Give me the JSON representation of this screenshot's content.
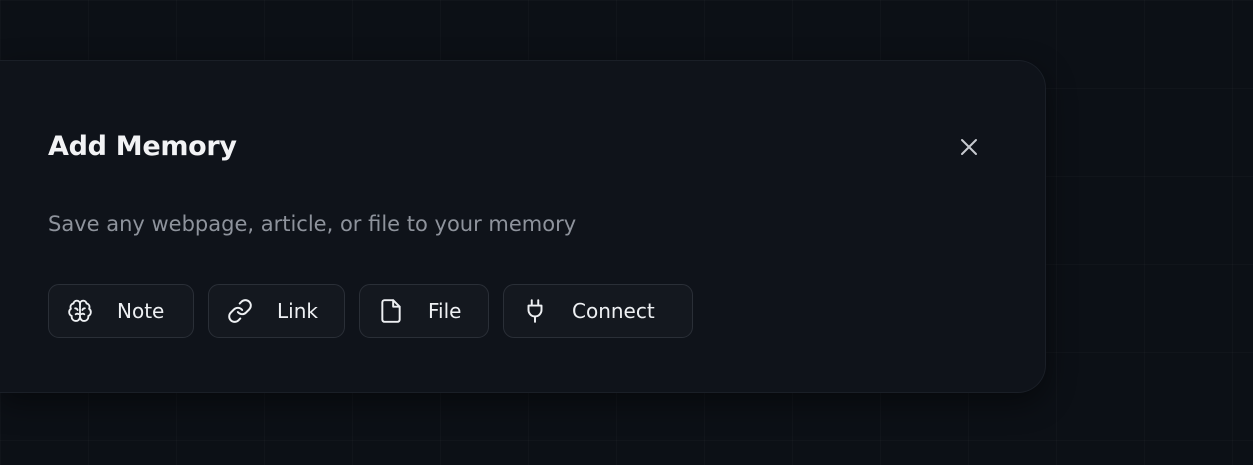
{
  "modal": {
    "title": "Add Memory",
    "subtitle": "Save any webpage, article, or file to your memory",
    "close_icon": "close-icon"
  },
  "actions": [
    {
      "label": "Note",
      "icon": "brain-icon"
    },
    {
      "label": "Link",
      "icon": "link-icon"
    },
    {
      "label": "File",
      "icon": "file-icon"
    },
    {
      "label": "Connect",
      "icon": "plug-icon"
    }
  ],
  "colors": {
    "background": "#0c1016",
    "modal": "#0f131a",
    "title": "#f2f3f5",
    "subtitle": "#8e939c",
    "button_border": "#2a2f37"
  }
}
